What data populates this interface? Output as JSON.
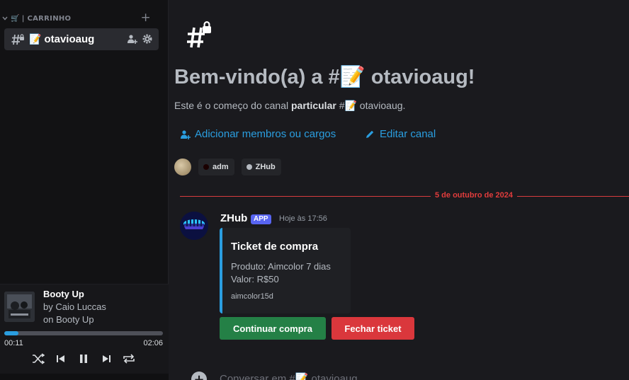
{
  "sidebar": {
    "category": {
      "icon": "shopping-cart-icon",
      "label": "| CARRINHO",
      "add": "+"
    },
    "channel": {
      "emoji": "📝",
      "name": "otavioaug"
    },
    "player": {
      "title": "Booty Up",
      "artist": "by Caio Luccas",
      "album": "on Booty Up",
      "progress": 0.09,
      "current_time": "00:11",
      "total_time": "02:06"
    }
  },
  "main": {
    "welcome": "Bem-vindo(a) a #📝 otavioaug!",
    "intro_before": "Este é o começo do canal ",
    "intro_bold": "particular",
    "intro_after": " #📝 otavioaug.",
    "add_members": "Adicionar membros ou cargos",
    "edit_channel": "Editar canal",
    "members": [
      {
        "name": "adm",
        "color": "#1a0000"
      },
      {
        "name": "ZHub",
        "color": "#b5bac1"
      }
    ],
    "date_divider": "5 de outubro de 2024",
    "message": {
      "author": "ZHub",
      "badge": "APP",
      "time": "Hoje às 17:56",
      "embed": {
        "title": "Ticket de compra",
        "line1": "Produto: Aimcolor 7 dias",
        "line2": "Valor: R$50",
        "footer": "aimcolor15d",
        "accent": "#2a9ee0"
      },
      "buttons": {
        "continue": "Continuar compra",
        "close": "Fechar ticket"
      }
    },
    "composer_placeholder": "Conversar em #📝 otavioaug"
  }
}
